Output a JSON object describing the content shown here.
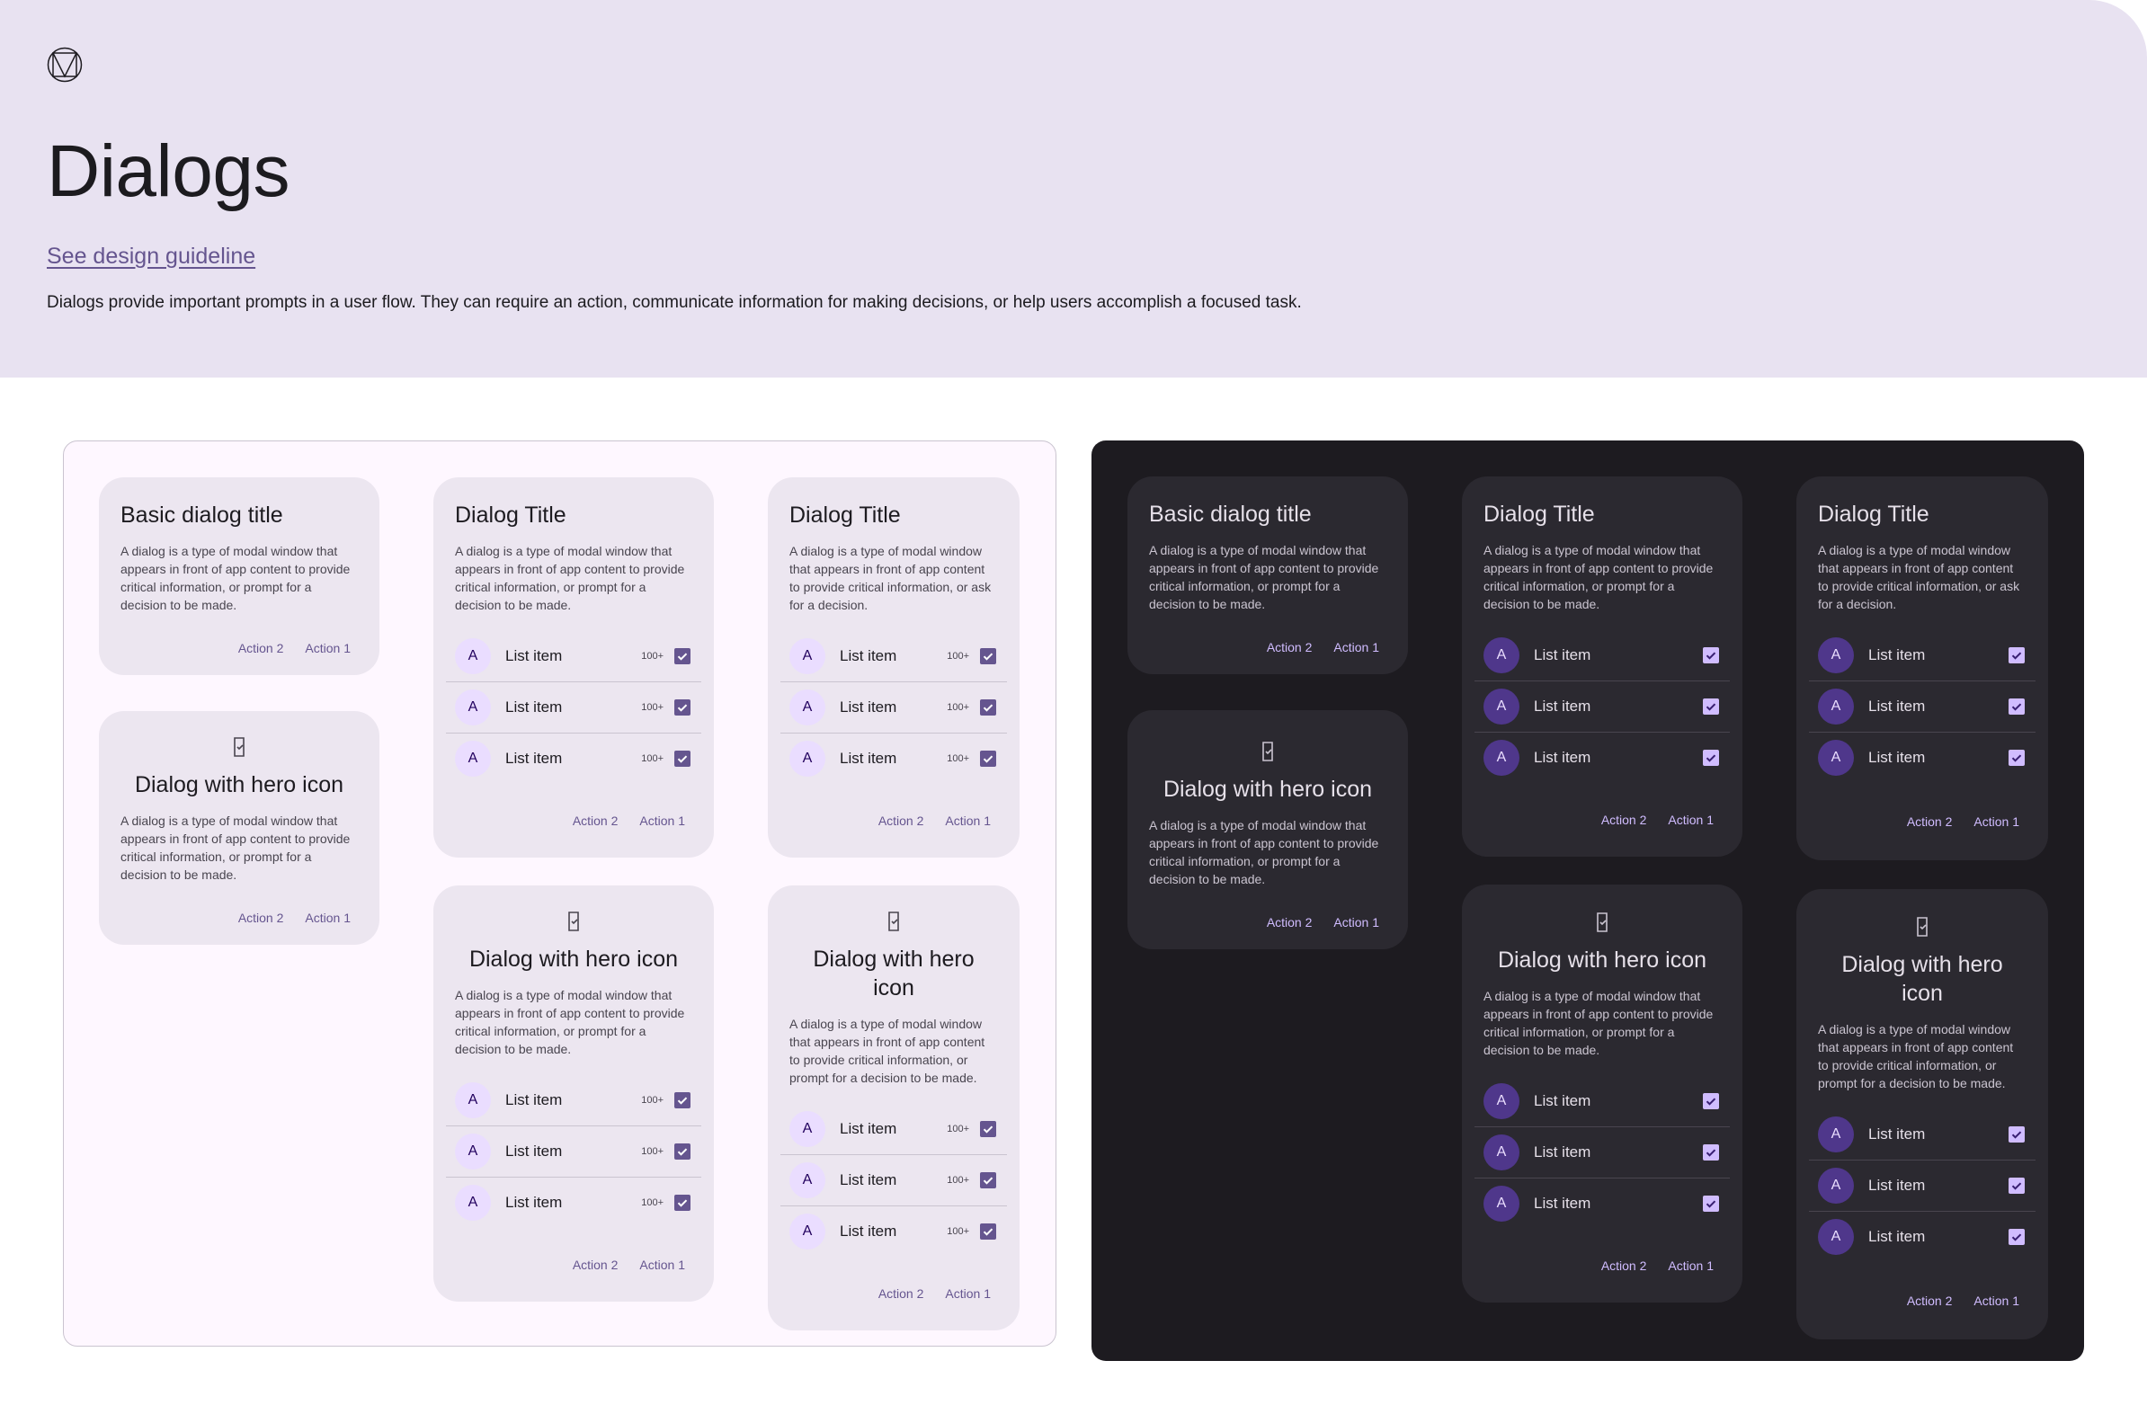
{
  "header": {
    "title": "Dialogs",
    "guideline_link": "See design guideline",
    "description": "Dialogs provide important prompts in a user flow. They can require an action, communicate information for making decisions, or help users accomplish a focused task."
  },
  "dialogs": {
    "basic_title": "Basic dialog title",
    "list_title": "Dialog Title",
    "hero_title": "Dialog with hero icon",
    "body": "A dialog is a type of modal window that appears in front of app content to provide critical information, or prompt for a decision to be made.",
    "body_ask": "A dialog is a type of modal window that appears in front of app content to provide critical information, or ask for a decision.",
    "action2": "Action 2",
    "action1": "Action 1",
    "list_item": "List item",
    "avatar_letter": "A",
    "meta": "100+"
  },
  "colors": {
    "primary": "#65558f",
    "header_bg": "#e8e2f1",
    "light_surface": "#ece6f0",
    "dark_surface": "#2b2930",
    "dark_primary": "#d0bcff"
  },
  "icons": {
    "logo": "material-logo-icon",
    "hero": "device-check-icon",
    "checkbox": "check-icon"
  }
}
